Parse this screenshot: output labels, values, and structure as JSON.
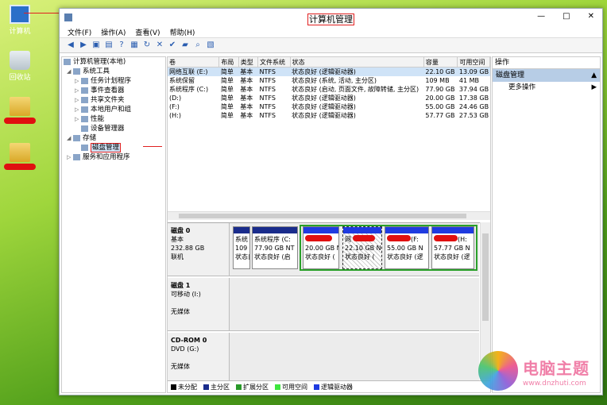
{
  "desktop": {
    "icons": [
      {
        "label": "计算机",
        "kind": "computer"
      },
      {
        "label": "回收站",
        "kind": "recycle-bin"
      },
      {
        "label": "",
        "kind": "folder"
      },
      {
        "label": "",
        "kind": "folder"
      }
    ]
  },
  "window": {
    "title": "计算机管理",
    "minimize": "—",
    "maximize": "□",
    "close": "✕"
  },
  "menu": [
    "文件(F)",
    "操作(A)",
    "查看(V)",
    "帮助(H)"
  ],
  "tree": [
    {
      "label": "计算机管理(本地)",
      "indent": 0,
      "exp": ""
    },
    {
      "label": "系统工具",
      "indent": 1,
      "exp": "◢"
    },
    {
      "label": "任务计划程序",
      "indent": 2,
      "exp": "▷"
    },
    {
      "label": "事件查看器",
      "indent": 2,
      "exp": "▷"
    },
    {
      "label": "共享文件夹",
      "indent": 2,
      "exp": "▷"
    },
    {
      "label": "本地用户和组",
      "indent": 2,
      "exp": "▷"
    },
    {
      "label": "性能",
      "indent": 2,
      "exp": "▷"
    },
    {
      "label": "设备管理器",
      "indent": 2,
      "exp": ""
    },
    {
      "label": "存储",
      "indent": 1,
      "exp": "◢"
    },
    {
      "label": "磁盘管理",
      "indent": 2,
      "exp": "",
      "selected": true
    },
    {
      "label": "服务和应用程序",
      "indent": 1,
      "exp": "▷"
    }
  ],
  "volumes": {
    "headers": [
      "卷",
      "布局",
      "类型",
      "文件系统",
      "状态",
      "容量",
      "可用空间"
    ],
    "rows": [
      [
        "网络互联 (E:)",
        "简单",
        "基本",
        "NTFS",
        "状态良好 (逻辑驱动器)",
        "22.10 GB",
        "13.09 GB"
      ],
      [
        "系统保留",
        "简单",
        "基本",
        "NTFS",
        "状态良好 (系统, 活动, 主分区)",
        "109 MB",
        "41 MB"
      ],
      [
        "系统程序 (C:)",
        "简单",
        "基本",
        "NTFS",
        "状态良好 (启动, 页面文件, 故障转储, 主分区)",
        "77.90 GB",
        "37.94 GB"
      ],
      [
        "(D:)",
        "简单",
        "基本",
        "NTFS",
        "状态良好 (逻辑驱动器)",
        "20.00 GB",
        "17.38 GB"
      ],
      [
        "(F:)",
        "简单",
        "基本",
        "NTFS",
        "状态良好 (逻辑驱动器)",
        "55.00 GB",
        "24.46 GB"
      ],
      [
        "(H:)",
        "简单",
        "基本",
        "NTFS",
        "状态良好 (逻辑驱动器)",
        "57.77 GB",
        "27.53 GB"
      ]
    ]
  },
  "disks": [
    {
      "name": "磁盘 0",
      "line1": "基本",
      "line2": "232.88 GB",
      "line3": "联机",
      "partitions": [
        {
          "l1": "系统",
          "l2": "109",
          "l3": "状态良",
          "bar": "#1a2c8c"
        },
        {
          "l1": "系统程序 (C:",
          "l2": "77.90 GB NT",
          "l3": "状态良好 (启",
          "bar": "#1a2c8c"
        },
        {
          "l1": "",
          "l2": "20.00 GB N",
          "l3": "状态良好 (",
          "bar": "#1f3be0"
        },
        {
          "l1": "网",
          "l2": "22.10 GB N",
          "l3": "状态良好 (",
          "bar": "#1f3be0"
        },
        {
          "l1": "(F:",
          "l2": "55.00 GB N",
          "l3": "状态良好 (逻",
          "bar": "#1f3be0"
        },
        {
          "l1": "(H:",
          "l2": "57.77 GB N",
          "l3": "状态良好 (逻",
          "bar": "#1f3be0"
        }
      ]
    },
    {
      "name": "磁盘 1",
      "line1": "可移动 (I:)",
      "line2": "",
      "line3": "无媒体"
    },
    {
      "name": "CD-ROM 0",
      "line1": "DVD (G:)",
      "line2": "",
      "line3": "无媒体"
    }
  ],
  "legend": [
    {
      "label": "未分配",
      "color": "#000000"
    },
    {
      "label": "主分区",
      "color": "#1a2c8c"
    },
    {
      "label": "扩展分区",
      "color": "#2a9a2a"
    },
    {
      "label": "可用空间",
      "color": "#3ee63e"
    },
    {
      "label": "逻辑驱动器",
      "color": "#1f3be0"
    }
  ],
  "actions": {
    "header": "操作",
    "selected": "磁盘管理",
    "more": "更多操作"
  },
  "watermark": {
    "brand": "电脑主题",
    "url": "www.dnzhuti.com"
  }
}
